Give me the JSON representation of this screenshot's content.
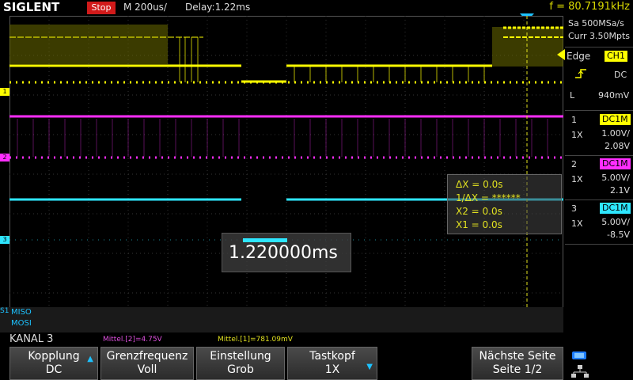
{
  "topbar": {
    "brand": "SIGLENT",
    "run_status": "Stop",
    "timebase": "M 200us/",
    "delay": "Delay:1.22ms",
    "frequency": "f = 80.7191kHz"
  },
  "acquisition": {
    "sample_rate": "Sa 500MSa/s",
    "memory_depth": "Curr 3.50Mpts"
  },
  "trigger": {
    "mode_label": "Edge",
    "source": "CH1",
    "coupling": "DC",
    "level_label": "L",
    "level_value": "940mV"
  },
  "channels": [
    {
      "num": "1",
      "coupling": "DC1M",
      "probe": "1X",
      "scale": "1.00V/",
      "offset": "2.08V",
      "color": "#ffff00"
    },
    {
      "num": "2",
      "coupling": "DC1M",
      "probe": "1X",
      "scale": "5.00V/",
      "offset": "2.1V",
      "color": "#ff2dff"
    },
    {
      "num": "3",
      "coupling": "DC1M",
      "probe": "1X",
      "scale": "5.00V/",
      "offset": "-8.5V",
      "color": "#2ee6ff"
    }
  ],
  "cursors": {
    "delta_x": "ΔX = 0.0s",
    "inv_delta_x": "1/ΔX = ******",
    "x2": "X2 = 0.0s",
    "x1": "X1 = 0.0s"
  },
  "delay_readout": "1.220000ms",
  "decode": {
    "bus_badge": "S1",
    "line1": "MISO",
    "line2": "MOSI"
  },
  "status": {
    "menu_title": "KANAL 3",
    "mean2": "Mittel.[2]=4.75V",
    "mean1": "Mittel.[1]=781.09mV"
  },
  "softkeys": [
    {
      "label": "Kopplung",
      "value": "DC"
    },
    {
      "label": "Grenzfrequenz",
      "value": "Voll"
    },
    {
      "label": "Einstellung",
      "value": "Grob"
    },
    {
      "label": "Tastkopf",
      "value": "1X"
    },
    {
      "label": "Nächste Seite",
      "value": "Seite 1/2"
    }
  ]
}
